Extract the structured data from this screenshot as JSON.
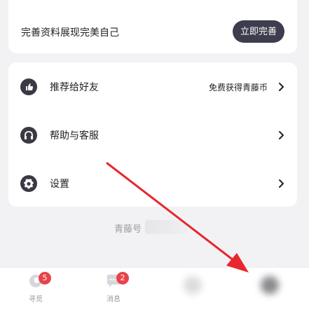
{
  "profile": {
    "prompt": "完善资料展现完美自己",
    "button_label": "立即完善"
  },
  "menu": {
    "items": [
      {
        "label": "推荐给好友",
        "extra": "免费获得青藤币",
        "icon": "thumbs-up-icon"
      },
      {
        "label": "帮助与客服",
        "extra": "",
        "icon": "headphones-icon"
      },
      {
        "label": "设置",
        "extra": "",
        "icon": "gear-icon"
      }
    ]
  },
  "account": {
    "id_label": "青藤号"
  },
  "tabbar": {
    "tabs": [
      {
        "label": "寻觅",
        "badge": "5",
        "icon": "discover-icon"
      },
      {
        "label": "消息",
        "badge": "2",
        "icon": "message-icon"
      }
    ]
  },
  "colors": {
    "accent": "#3d3d4e",
    "badge": "#e8434b",
    "annotation_arrow": "#e8262d"
  }
}
